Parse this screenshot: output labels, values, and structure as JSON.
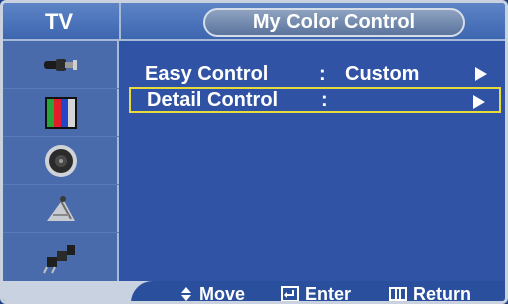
{
  "header": {
    "section_label": "TV",
    "menu_title": "My Color Control"
  },
  "sidebar": {
    "icons": [
      "input-plug-icon",
      "color-bars-icon",
      "speaker-icon",
      "satellite-dish-icon",
      "plugs-icon"
    ]
  },
  "menu": {
    "items": [
      {
        "label": "Easy Control",
        "separator": ":",
        "value": "Custom",
        "selected": false
      },
      {
        "label": "Detail Control",
        "separator": ":",
        "value": "",
        "selected": true
      }
    ]
  },
  "footer": {
    "move_label": "Move",
    "enter_label": "Enter",
    "return_label": "Return"
  },
  "colors": {
    "panel_blue": "#3153a6",
    "selection_yellow": "#e7da3b",
    "text_white": "#ffffff"
  }
}
